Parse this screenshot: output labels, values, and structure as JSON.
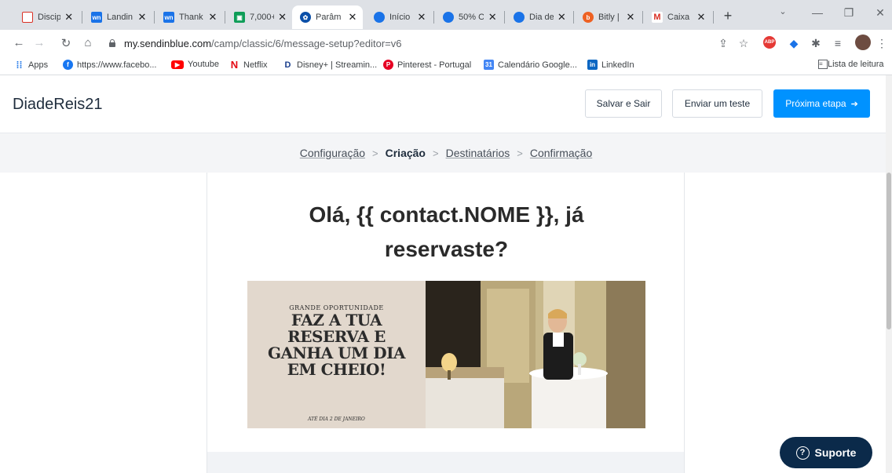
{
  "browser": {
    "tabs": [
      {
        "title": "Discipl",
        "icon": "checkbox-icon",
        "color": "#d93025"
      },
      {
        "title": "Landin",
        "icon": "wn-icon",
        "color": "#1a73e8"
      },
      {
        "title": "Thank",
        "icon": "wn-icon",
        "color": "#1a73e8"
      },
      {
        "title": "7,000+",
        "icon": "doc-icon",
        "color": "#0f9d58"
      },
      {
        "title": "Parâm",
        "icon": "sendinblue-icon",
        "color": "#0b4fa8"
      },
      {
        "title": "Início",
        "icon": "circle-icon",
        "color": "#1a73e8"
      },
      {
        "title": "50% O",
        "icon": "circle-icon",
        "color": "#1a73e8"
      },
      {
        "title": "Dia de",
        "icon": "circle-icon",
        "color": "#1a73e8"
      },
      {
        "title": "Bitly |",
        "icon": "bitly-icon",
        "color": "#ee6123"
      },
      {
        "title": "Caixa",
        "icon": "gmail-icon",
        "color": "#d93025"
      }
    ],
    "close_glyph": "✕",
    "new_tab_glyph": "+",
    "url_host": "my.sendinblue.com",
    "url_path": "/camp/classic/6/message-setup?editor=v6"
  },
  "bookmarks": {
    "apps": "Apps",
    "items": [
      {
        "label": "https://www.facebo...",
        "icon": "facebook-icon",
        "color": "#1877f2"
      },
      {
        "label": "Youtube",
        "icon": "youtube-icon",
        "color": "#ff0000"
      },
      {
        "label": "Netflix",
        "icon": "netflix-icon",
        "color": "#e50914"
      },
      {
        "label": "Disney+ | Streamin...",
        "icon": "disney-icon",
        "color": "#1a3e8c"
      },
      {
        "label": "Pinterest - Portugal",
        "icon": "pinterest-icon",
        "color": "#e60023"
      },
      {
        "label": "Calendário Google...",
        "icon": "calendar-icon",
        "color": "#4285f4"
      },
      {
        "label": "LinkedIn",
        "icon": "linkedin-icon",
        "color": "#0a66c2"
      }
    ],
    "reading_list": "Lista de leitura"
  },
  "header": {
    "brand": "DiadeReis21",
    "save_exit": "Salvar e Sair",
    "send_test": "Enviar um teste",
    "next_step": "Próxima etapa",
    "accent": "#0092ff"
  },
  "steps": {
    "items": [
      "Configuração",
      "Criação",
      "Destinatários",
      "Confirmação"
    ],
    "current": "Criação",
    "separator": ">"
  },
  "email": {
    "headline_line1": "Olá, {{ contact.NOME }}, já",
    "headline_line2": "reservaste?",
    "banner": {
      "kicker": "GRANDE OPORTUNIDADE",
      "title_1": "FAZ A TUA",
      "title_2": "RESERVA E",
      "title_3": "GANHA UM DIA",
      "title_4": "EM CHEIO!",
      "date": "ATÉ DIA 2 DE JANEIRO"
    }
  },
  "support": {
    "label": "Suporte",
    "icon": "question-icon",
    "color": "#0b2a4a"
  }
}
